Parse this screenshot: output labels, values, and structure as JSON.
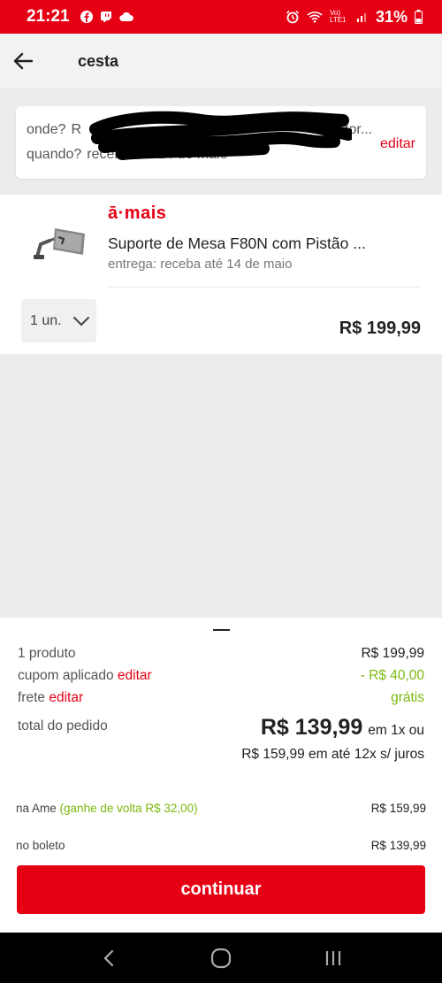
{
  "status_bar": {
    "time": "21:21",
    "icons": [
      "facebook-icon",
      "twitch-icon",
      "cloud-icon"
    ],
    "right_icons": [
      "alarm-icon",
      "wifi-icon",
      "lte-signal-icon"
    ],
    "volte": "Vo) LTE1",
    "battery": "31%"
  },
  "header": {
    "title": "cesta"
  },
  "address": {
    "where_label": "onde?",
    "where_value": "R",
    "where_tail": "tor...",
    "when_label": "quando?",
    "when_value": "receba até 14 de maio",
    "edit": "editar"
  },
  "product": {
    "seller": "ā·mais",
    "name": "Suporte de Mesa F80N com Pistão ...",
    "delivery": "entrega: receba até 14 de maio",
    "quantity": "1 un.",
    "price": "R$ 199,99"
  },
  "summary": {
    "items_label": "1 produto",
    "items_value": "R$ 199,99",
    "coupon_label": "cupom aplicado",
    "coupon_edit": "editar",
    "coupon_value": "- R$ 40,00",
    "shipping_label": "frete",
    "shipping_edit": "editar",
    "shipping_value": "grátis",
    "total_label": "total do pedido",
    "total_value": "R$ 139,99",
    "total_suffix": "em 1x ou",
    "installments": "R$ 159,99 em até 12x s/ juros",
    "ame_label": "na Ame",
    "ame_cashback": "(ganhe de volta R$ 32,00)",
    "ame_value": "R$ 159,99",
    "boleto_label": "no boleto",
    "boleto_value": "R$ 139,99",
    "continue": "continuar"
  },
  "colors": {
    "brand_red": "#e60014",
    "green": "#7ab80e"
  }
}
